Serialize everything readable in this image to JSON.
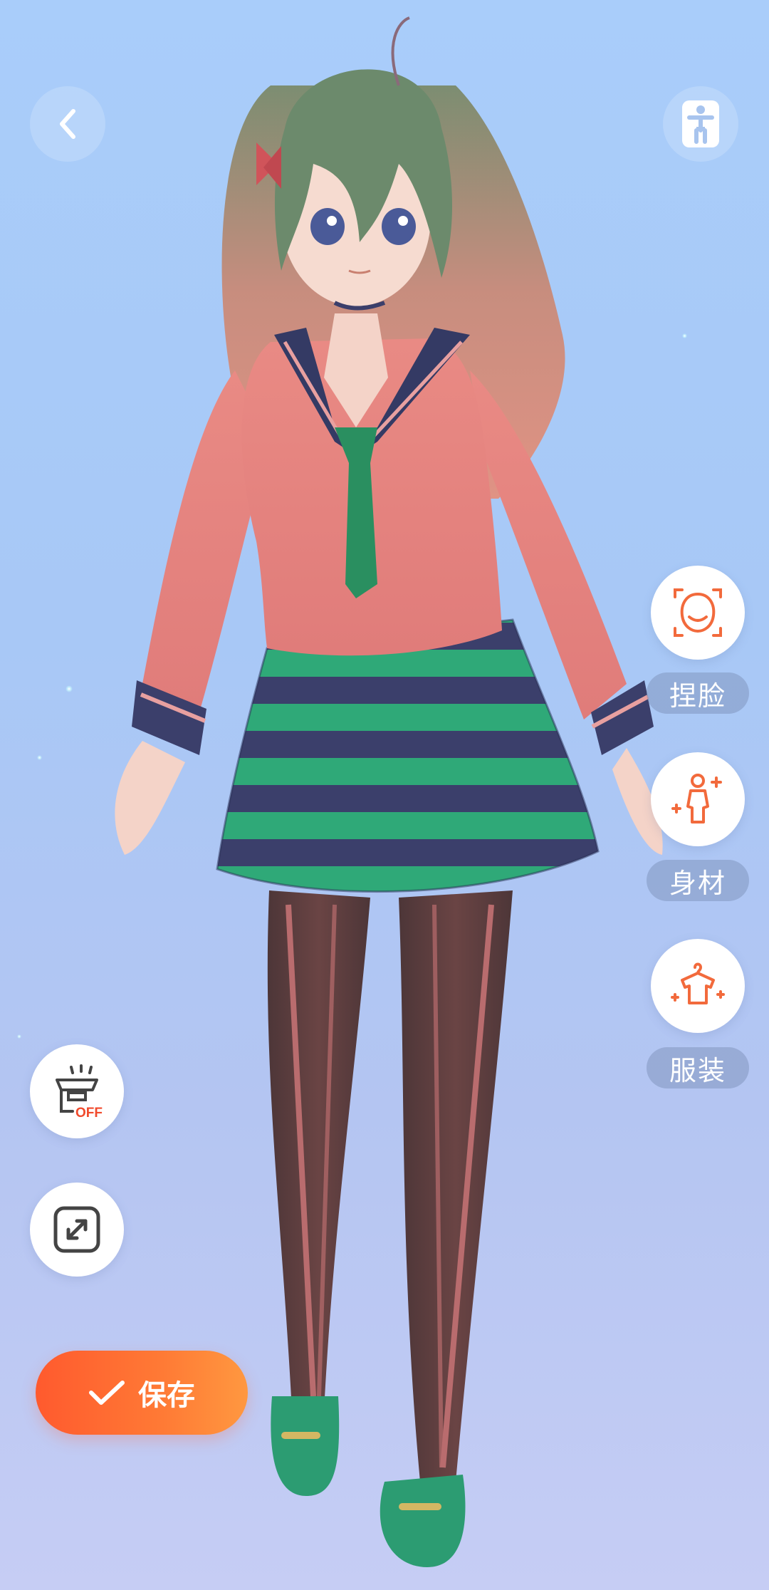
{
  "toolbar": {
    "back_icon": "chevron-left-icon",
    "pose_icon": "standing-figure-icon"
  },
  "side_menu": [
    {
      "id": "face",
      "label": "捏脸",
      "icon": "face-edit-icon"
    },
    {
      "id": "body",
      "label": "身材",
      "icon": "body-shape-icon"
    },
    {
      "id": "outfit",
      "label": "服装",
      "icon": "clothes-hanger-icon"
    }
  ],
  "left_tools": {
    "light_toggle_badge": "OFF",
    "light_toggle_icon": "lamp-off-icon",
    "fullscreen_icon": "expand-icon"
  },
  "save": {
    "label": "保存",
    "icon": "check-icon"
  },
  "colors": {
    "accent": "#f26a3c",
    "save_gradient_start": "#ff5a2e",
    "save_gradient_end": "#ff9840",
    "background_top": "#a9cdfa",
    "background_bottom": "#c6cdf4"
  }
}
